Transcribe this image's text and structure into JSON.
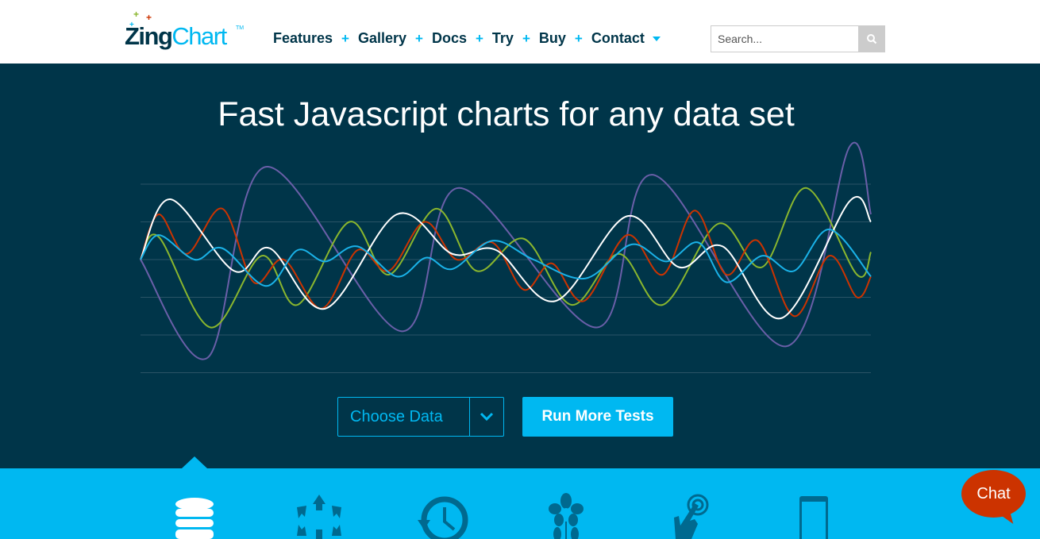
{
  "logo": {
    "part1": "Zing",
    "part2": "Chart",
    "tm": "TM"
  },
  "nav": {
    "items": [
      "Features",
      "Gallery",
      "Docs",
      "Try",
      "Buy",
      "Contact"
    ],
    "separator": "+"
  },
  "search": {
    "placeholder": "Search...",
    "value": ""
  },
  "hero": {
    "title": "Fast Javascript charts for any data set",
    "choose_label": "Choose Data",
    "run_label": "Run More Tests"
  },
  "colors": {
    "dark": "#003549",
    "accent": "#00b8f1",
    "chat": "#cc3300"
  },
  "chat": {
    "label": "Chat"
  },
  "features": {
    "icons": [
      "database-icon",
      "arrows-network-icon",
      "history-clock-icon",
      "flower-icon",
      "touch-hand-icon",
      "mobile-phone-icon"
    ]
  },
  "chart_data": {
    "type": "line",
    "ylim": [
      -3,
      3.2
    ],
    "xlim": [
      0,
      100
    ],
    "grid": true,
    "series": [
      {
        "color": "#6a5fa8",
        "points": [
          [
            0,
            0
          ],
          [
            9.2,
            -2.6
          ],
          [
            17.2,
            2.46
          ],
          [
            35.7,
            -1.9
          ],
          [
            43.6,
            1.9
          ],
          [
            62.5,
            -1.8
          ],
          [
            70.1,
            2.25
          ],
          [
            88.4,
            -2.3
          ],
          [
            97.1,
            3.0
          ],
          [
            100,
            1.2
          ]
        ]
      },
      {
        "color": "#8ab62e",
        "points": [
          [
            0,
            0
          ],
          [
            2.5,
            0.6
          ],
          [
            9.6,
            -1.8
          ],
          [
            16.6,
            0.1
          ],
          [
            21.5,
            -1.2
          ],
          [
            28.6,
            1.0
          ],
          [
            34,
            -0.4
          ],
          [
            40.5,
            1.35
          ],
          [
            46,
            -0.3
          ],
          [
            52.5,
            0.55
          ],
          [
            59,
            -1.2
          ],
          [
            65.5,
            0.15
          ],
          [
            71.5,
            -1.2
          ],
          [
            79.1,
            0.95
          ],
          [
            85.1,
            -0.2
          ],
          [
            91.1,
            1.9
          ],
          [
            98.1,
            -0.4
          ],
          [
            100,
            0.2
          ]
        ]
      },
      {
        "color": "#cc3300",
        "points": [
          [
            0,
            0
          ],
          [
            2.5,
            1.2
          ],
          [
            6.3,
            0.15
          ],
          [
            11.2,
            1.35
          ],
          [
            15.5,
            -0.6
          ],
          [
            19.6,
            0
          ],
          [
            24.8,
            -1.3
          ],
          [
            29.7,
            0.25
          ],
          [
            34,
            -0.3
          ],
          [
            38.9,
            1.0
          ],
          [
            43.3,
            0
          ],
          [
            48.2,
            0.45
          ],
          [
            52.5,
            -0.8
          ],
          [
            56.3,
            -0.1
          ],
          [
            60.7,
            -1.1
          ],
          [
            66.6,
            0.65
          ],
          [
            71.5,
            -0.4
          ],
          [
            75.9,
            1.3
          ],
          [
            80.2,
            -0.4
          ],
          [
            84.5,
            0.5
          ],
          [
            89.5,
            -1.5
          ],
          [
            94.3,
            0.1
          ],
          [
            98.1,
            -1.0
          ],
          [
            100,
            -0.45
          ]
        ]
      },
      {
        "color": "#ffffff",
        "points": [
          [
            0,
            0
          ],
          [
            4.1,
            1.6
          ],
          [
            12.8,
            -0.3
          ],
          [
            17.7,
            0.3
          ],
          [
            25.3,
            -1.3
          ],
          [
            35.1,
            1.2
          ],
          [
            42.7,
            0.15
          ],
          [
            48.7,
            0.25
          ],
          [
            56.8,
            -1.1
          ],
          [
            66.6,
            1.15
          ],
          [
            73.7,
            -0.2
          ],
          [
            79.7,
            0.35
          ],
          [
            87.8,
            -1.55
          ],
          [
            97.1,
            1.55
          ],
          [
            100,
            1.0
          ]
        ]
      },
      {
        "color": "#1ab2e8",
        "points": [
          [
            0,
            0
          ],
          [
            2.5,
            0.65
          ],
          [
            7.4,
            0
          ],
          [
            11.2,
            0.3
          ],
          [
            17.2,
            -0.7
          ],
          [
            21.5,
            0.25
          ],
          [
            25.3,
            -0.05
          ],
          [
            29.7,
            0.35
          ],
          [
            35.1,
            -0.45
          ],
          [
            39.1,
            0.05
          ],
          [
            42.7,
            -0.25
          ],
          [
            48.2,
            0.5
          ],
          [
            53.8,
            0
          ],
          [
            60.9,
            -0.5
          ],
          [
            67.2,
            0.4
          ],
          [
            72,
            -0.05
          ],
          [
            76.4,
            0.45
          ],
          [
            80.2,
            -0.6
          ],
          [
            85.1,
            0.1
          ],
          [
            89.5,
            -0.3
          ],
          [
            94.3,
            0.8
          ],
          [
            100,
            -0.45
          ]
        ]
      }
    ]
  }
}
